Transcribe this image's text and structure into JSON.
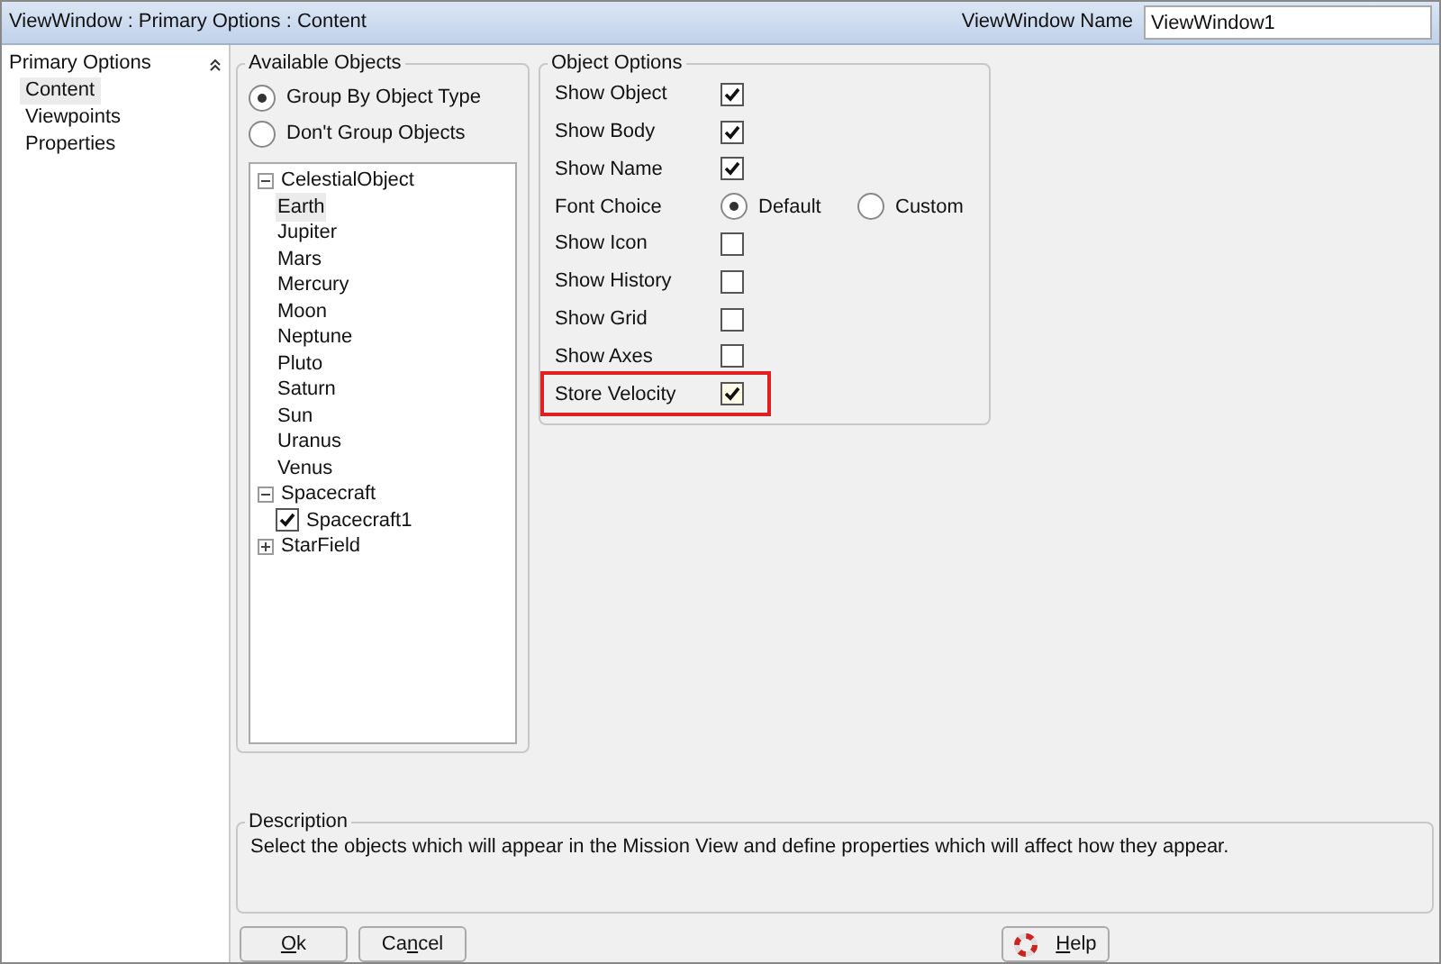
{
  "window": {
    "title": "ViewWindow : Primary Options : Content"
  },
  "name_field": {
    "label": "ViewWindow Name",
    "value": "ViewWindow1"
  },
  "sidebar": {
    "title": "Primary Options",
    "items": [
      {
        "label": "Content",
        "selected": true
      },
      {
        "label": "Viewpoints",
        "selected": false
      },
      {
        "label": "Properties",
        "selected": false
      }
    ]
  },
  "available_objects": {
    "title": "Available Objects",
    "grouping": [
      {
        "label": "Group By Object Type",
        "selected": true
      },
      {
        "label": "Don't Group Objects",
        "selected": false
      }
    ],
    "tree": [
      {
        "label": "CelestialObject",
        "expanded": true,
        "children": [
          {
            "label": "Earth",
            "selected": true
          },
          {
            "label": "Jupiter",
            "selected": false
          },
          {
            "label": "Mars",
            "selected": false
          },
          {
            "label": "Mercury",
            "selected": false
          },
          {
            "label": "Moon",
            "selected": false
          },
          {
            "label": "Neptune",
            "selected": false
          },
          {
            "label": "Pluto",
            "selected": false
          },
          {
            "label": "Saturn",
            "selected": false
          },
          {
            "label": "Sun",
            "selected": false
          },
          {
            "label": "Uranus",
            "selected": false
          },
          {
            "label": "Venus",
            "selected": false
          }
        ]
      },
      {
        "label": "Spacecraft",
        "expanded": true,
        "children": [
          {
            "label": "Spacecraft1",
            "selected": false,
            "checked": true
          }
        ]
      },
      {
        "label": "StarField",
        "expanded": false
      }
    ]
  },
  "object_options": {
    "title": "Object Options",
    "rows": [
      {
        "kind": "checkbox",
        "label": "Show Object",
        "checked": true,
        "highlighted": false
      },
      {
        "kind": "checkbox",
        "label": "Show Body",
        "checked": true,
        "highlighted": false
      },
      {
        "kind": "checkbox",
        "label": "Show Name",
        "checked": true,
        "highlighted": false
      },
      {
        "kind": "radio",
        "label": "Font Choice",
        "options": [
          {
            "label": "Default",
            "selected": true
          },
          {
            "label": "Custom",
            "selected": false
          }
        ],
        "highlighted": false
      },
      {
        "kind": "checkbox",
        "label": "Show Icon",
        "checked": false,
        "highlighted": false
      },
      {
        "kind": "checkbox",
        "label": "Show History",
        "checked": false,
        "highlighted": false
      },
      {
        "kind": "checkbox",
        "label": "Show Grid",
        "checked": false,
        "highlighted": false
      },
      {
        "kind": "checkbox",
        "label": "Show Axes",
        "checked": false,
        "highlighted": false
      },
      {
        "kind": "checkbox",
        "label": "Store Velocity",
        "checked": true,
        "highlighted": true
      }
    ]
  },
  "description": {
    "title": "Description",
    "text": "Select the objects which will appear in the Mission View and define properties which will affect how they appear."
  },
  "buttons": [
    {
      "access_key": "O",
      "rest": "k",
      "kind": "plain"
    },
    {
      "lead": "Ca",
      "access_key": "n",
      "rest": "cel",
      "kind": "plain"
    },
    {
      "access_key": "H",
      "rest": "elp",
      "kind": "help"
    }
  ]
}
